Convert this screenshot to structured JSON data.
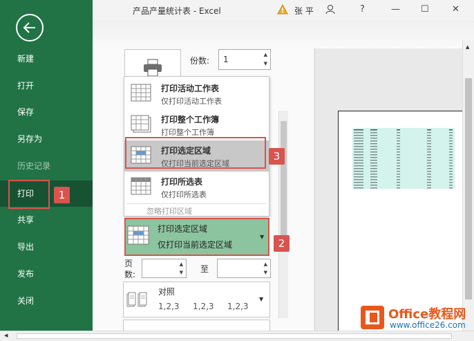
{
  "window": {
    "title": "产品产量统计表  -  Excel",
    "user": "张 平",
    "help": "?",
    "minimize": "—",
    "restore": "☐",
    "close": "✕"
  },
  "sidebar": {
    "items": [
      {
        "label": "新建"
      },
      {
        "label": "打开"
      },
      {
        "label": "保存"
      },
      {
        "label": "另存为"
      },
      {
        "label": "历史记录"
      },
      {
        "label": "打印"
      },
      {
        "label": "共享"
      },
      {
        "label": "导出"
      },
      {
        "label": "发布"
      },
      {
        "label": "关闭"
      }
    ],
    "active": "打印"
  },
  "callouts": [
    "1",
    "2",
    "3"
  ],
  "print": {
    "copies_label": "份数:",
    "copies_value": "1",
    "menu": [
      {
        "title": "打印活动工作表",
        "subtitle": "仅打印活动工作表"
      },
      {
        "title": "打印整个工作簿",
        "subtitle": "打印整个工作簿"
      },
      {
        "title": "打印选定区域",
        "subtitle": "仅打印当前选定区域"
      },
      {
        "title": "打印所选表",
        "subtitle": "仅打印所选表"
      }
    ],
    "ignore_print_area": "忽略打印区域",
    "selected_setting": {
      "title": "打印选定区域",
      "subtitle": "仅打印当前选定区域"
    },
    "pages_label": "页数:",
    "to_label": "至",
    "collate": {
      "title": "对照",
      "sequence": [
        "1,2,3",
        "1,2,3",
        "1,2,3"
      ]
    }
  },
  "watermark": {
    "brand": "Office教程网",
    "url": "www.office26.com"
  },
  "colors": {
    "sidebar": "#217346",
    "highlight": "#d9534f",
    "selected_setting": "#8cc49f"
  }
}
